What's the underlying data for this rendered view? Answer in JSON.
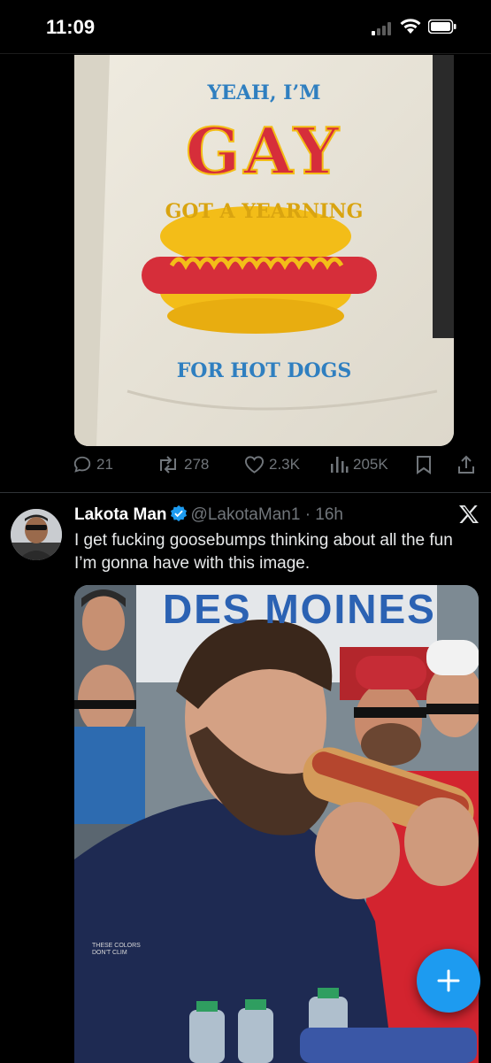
{
  "status_bar": {
    "time": "11:09"
  },
  "tweet1": {
    "image": {
      "shirt_lines": [
        "YEAH, I’M",
        "GAY",
        "GOT A YEARNING",
        "FOR HOT DOGS"
      ]
    },
    "actions": {
      "replies": "21",
      "reposts": "278",
      "likes": "2.3K",
      "views": "205K"
    }
  },
  "tweet2": {
    "name": "Lakota Man",
    "handle": "@LakotaMan1",
    "separator": "·",
    "age": "16h",
    "text": "I get fucking goosebumps thinking about all the fun I’m gonna have with this image.",
    "image": {
      "banner_text": "DES MOINES",
      "watermark": "THESE COLORS DON'T CLIM"
    }
  },
  "colors": {
    "accent": "#1d9bf0",
    "muted": "#71767b",
    "background": "#000000"
  },
  "icons": [
    "reply-icon",
    "repost-icon",
    "like-icon",
    "views-icon",
    "bookmark-icon",
    "share-icon",
    "verified-icon",
    "x-logo-icon",
    "plus-icon"
  ]
}
